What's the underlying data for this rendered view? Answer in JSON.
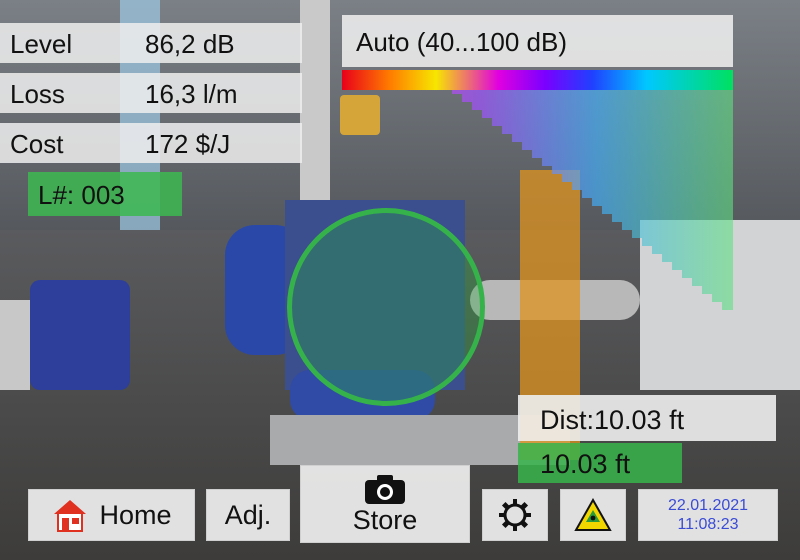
{
  "measurements": {
    "level": {
      "label": "Level",
      "value": "86,2 dB"
    },
    "loss": {
      "label": "Loss",
      "value": "16,3 l/m"
    },
    "cost": {
      "label": "Cost",
      "value": "172 $/J"
    },
    "location": "L#: 003"
  },
  "scale": {
    "mode": "Auto (40...100 dB)"
  },
  "distance": {
    "label": "Dist:10.03 ft",
    "value": "10.03 ft"
  },
  "toolbar": {
    "home_label": "Home",
    "adjust_label": "Adj.",
    "store_label": "Store",
    "home_icon": "home-icon",
    "camera_icon": "camera-icon",
    "settings_icon": "gear-icon",
    "warning_icon": "hazard-warning-icon"
  },
  "datetime": {
    "date": "22.01.2021",
    "time": "11:08:23"
  },
  "colors": {
    "accent_green": "#35b34a",
    "date_text": "#3a4bd6"
  }
}
